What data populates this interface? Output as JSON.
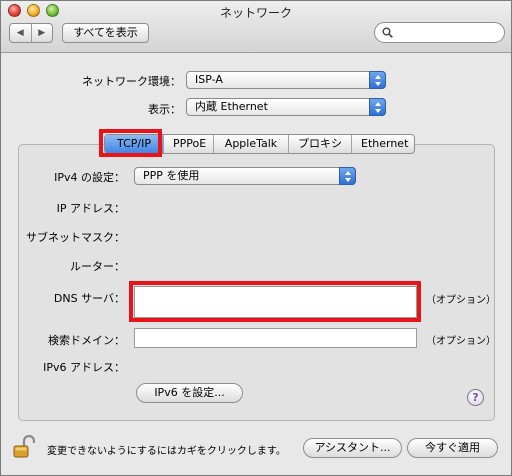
{
  "window": {
    "title": "ネットワーク"
  },
  "toolbar": {
    "back_glyph": "◀",
    "forward_glyph": "▶",
    "show_all_label": "すべてを表示",
    "search_placeholder": ""
  },
  "location": {
    "label": "ネットワーク環境：",
    "value": "ISP-A"
  },
  "show": {
    "label": "表示：",
    "value": "内蔵 Ethernet"
  },
  "tabs": [
    {
      "label": "TCP/IP",
      "selected": true
    },
    {
      "label": "PPPoE",
      "selected": false
    },
    {
      "label": "AppleTalk",
      "selected": false
    },
    {
      "label": "プロキシ",
      "selected": false
    },
    {
      "label": "Ethernet",
      "selected": false
    }
  ],
  "tcpip": {
    "ipv4_label": "IPv4 の設定：",
    "ipv4_value": "PPP を使用",
    "ip_address_label": "IP アドレス：",
    "subnet_label": "サブネットマスク：",
    "router_label": "ルーター：",
    "dns_label": "DNS サーバ：",
    "dns_value": "",
    "dns_optional": "（オプション）",
    "search_domain_label": "検索ドメイン：",
    "search_domain_value": "",
    "search_domain_optional": "（オプション）",
    "ipv6_label": "IPv6 アドレス：",
    "ipv6_button": "IPv6 を設定..."
  },
  "help_glyph": "?",
  "footer": {
    "lock_text": "変更できないようにするにはカギをクリックします。",
    "assistant_button": "アシスタント...",
    "apply_button": "今すぐ適用"
  },
  "colors": {
    "highlight_red": "#e8141a",
    "selection_blue": "#3f86e6"
  }
}
